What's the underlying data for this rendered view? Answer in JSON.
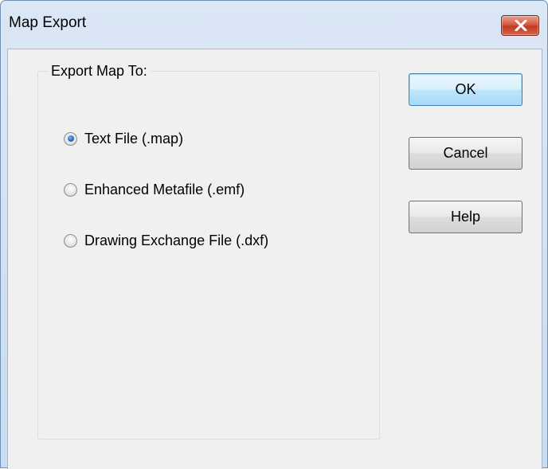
{
  "window": {
    "title": "Map Export",
    "close_icon": "close-icon",
    "close_color": "#c94a32"
  },
  "group": {
    "legend": "Export Map To:",
    "options": [
      {
        "label": "Text File (.map)",
        "checked": true
      },
      {
        "label": "Enhanced Metafile (.emf)",
        "checked": false
      },
      {
        "label": "Drawing Exchange File (.dxf)",
        "checked": false
      }
    ]
  },
  "buttons": {
    "ok": "OK",
    "cancel": "Cancel",
    "help": "Help"
  }
}
